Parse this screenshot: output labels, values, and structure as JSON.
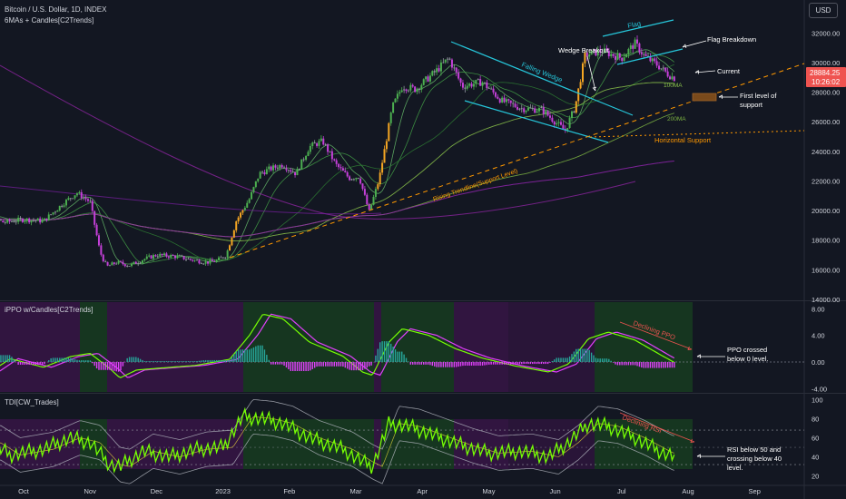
{
  "header": {
    "symbol_title": "Bitcoin / U.S. Dollar, 1D, INDEX",
    "indicator_main": "6MAs + Candles[C2Trends]",
    "currency_badge": "USD"
  },
  "price_panel": {
    "current_price": "28884.25",
    "countdown": "10:26:02",
    "y_ticks": [
      "32000.00",
      "30000.00",
      "28000.00",
      "26000.00",
      "24000.00",
      "22000.00",
      "20000.00",
      "18000.00",
      "16000.00",
      "14000.00"
    ]
  },
  "ppo_panel": {
    "title": "iPPO w/Candles[C2Trends]",
    "y_ticks": [
      "8.00",
      "4.00",
      "0.00",
      "-4.00"
    ]
  },
  "tdi_panel": {
    "title": "TDI[CW_Trades]",
    "y_ticks": [
      "100",
      "80",
      "60",
      "40",
      "20"
    ]
  },
  "x_axis": {
    "labels": [
      "Oct",
      "Nov",
      "Dec",
      "2023",
      "Feb",
      "Mar",
      "Apr",
      "May",
      "Jun",
      "Jul",
      "Aug",
      "Sep"
    ]
  },
  "annotations": {
    "flag": "Flag",
    "wedge_breakout": "Wedge Breakout",
    "flag_breakdown": "Flag Breakdown",
    "falling_wedge": "Falling Wedge",
    "current": "Current",
    "ma100": "100MA",
    "ma200": "200MA",
    "first_support_line1": "First level of",
    "first_support_line2": "support",
    "horizontal_support": "Horizontal Support",
    "rising_trendline": "Rising Trendline(Support Level)",
    "declining_ppo": "Declining PPO",
    "ppo_note_line1": "PPO crossed",
    "ppo_note_line2": "below 0 level.",
    "declining_rsi": "Declining RSI",
    "rsi_note_line1": "RSI below 50 and",
    "rsi_note_line2": "crossing below 40",
    "rsi_note_line3": "level."
  },
  "colors": {
    "background": "#131722",
    "bull_candle": "#4caf50",
    "bear_candle": "#c440d8",
    "neutral_candle": "#9598a1",
    "breakout_candle": "#f5a623",
    "channel_lines": "#26c6da",
    "support_orange": "#ff9800",
    "price_badge": "#ef5350",
    "annotation_red": "#ef5350",
    "rsi_green": "#76ff03",
    "ppo_magenta": "#e040fb"
  },
  "chart_data": [
    {
      "type": "candlestick",
      "title": "Bitcoin / U.S. Dollar, 1D, INDEX",
      "x": [
        "Oct",
        "Nov",
        "Dec",
        "2023",
        "Feb",
        "Mar",
        "Apr",
        "May",
        "Jun",
        "Jul",
        "Aug",
        "Sep"
      ],
      "ylim": [
        14000,
        33000
      ],
      "series": [
        {
          "name": "close",
          "x": [
            "Oct",
            "Nov",
            "Dec",
            "2023",
            "Feb",
            "Mar",
            "Apr",
            "May",
            "Jun",
            "Jul",
            "Aug"
          ],
          "values": [
            19400,
            20500,
            17000,
            16600,
            23100,
            23500,
            28400,
            29200,
            27000,
            30600,
            28900
          ]
        }
      ],
      "current_price": 28884.25
    },
    {
      "type": "line",
      "title": "iPPO w/Candles[C2Trends]",
      "x": [
        "Oct",
        "Nov",
        "Dec",
        "2023",
        "Feb",
        "Mar",
        "Apr",
        "May",
        "Jun",
        "Jul",
        "Aug"
      ],
      "ylim": [
        -4.5,
        9
      ],
      "series": [
        {
          "values": [
            -0.5,
            0.3,
            -2.0,
            -0.4,
            6.5,
            0.3,
            3.8,
            0.2,
            -0.2,
            4.3,
            -0.2
          ]
        }
      ]
    },
    {
      "type": "line",
      "title": "TDI[CW_Trades]",
      "x": [
        "Oct",
        "Nov",
        "Dec",
        "2023",
        "Feb",
        "Mar",
        "Apr",
        "May",
        "Jun",
        "Jul",
        "Aug"
      ],
      "ylim": [
        15,
        105
      ],
      "series": [
        {
          "values": [
            48,
            55,
            45,
            50,
            78,
            35,
            72,
            48,
            42,
            70,
            38
          ]
        }
      ]
    }
  ]
}
